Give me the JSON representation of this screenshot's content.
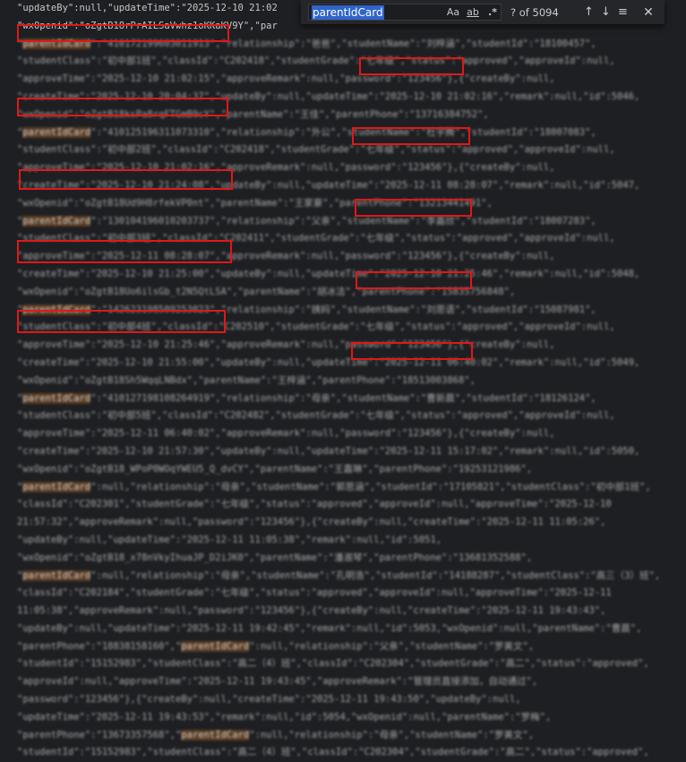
{
  "find_widget": {
    "query": "parentIdCard",
    "match_case_label": "Aa",
    "whole_word_label": "ab",
    "regex_label": ".*",
    "match_count": "? of 5094",
    "prev_icon": "arrow-up-icon",
    "next_icon": "arrow-down-icon",
    "selection_icon": "find-in-selection-icon",
    "close_icon": "close-icon"
  },
  "editor": {
    "lines": [
      {
        "text": "\"updateBy\":null,\"updateTime\":\"2025-12-10 21:02",
        "blur": false
      },
      {
        "text": "\"wxOpenid\":\"oZgtB18rPrAILSaVwhz1oKKaKV9Y\",\"par",
        "blur": false
      },
      {
        "text": "\"parentIdCard\":\"410172199603011913\",\"relationship\":\"爸爸\",\"studentName\":\"刘梓涵\",\"studentId\":\"18100457\",",
        "blur": true
      },
      {
        "text": "\"studentClass\":\"初中部1班\",\"classId\":\"C202418\",\"studentGrade\":\"七年级\",\"status\":\"approved\",\"approveId\":null,",
        "blur": true
      },
      {
        "text": "\"approveTime\":\"2025-12-10 21:02:15\",\"approveRemark\":null,\"password\":\"123456\"},{\"createBy\":null,",
        "blur": true
      },
      {
        "text": "\"createTime\":\"2025-12-10 20:04:37\",\"updateBy\":null,\"updateTime\":\"2025-12-10 21:02:16\",\"remark\":null,\"id\":5046,",
        "blur": true
      },
      {
        "text": "\"wxOpenid\":\"oZgtB18ksPa8rqFTGmB9cY\",\"parentName\":\"王佳\",\"parentPhone\":\"13716384752\",",
        "blur": true
      },
      {
        "text": "\"parentIdCard\":\"410125196311073310\",\"relationship\":\"外公\",\"studentName\":\"杜宇腾\",\"studentId\":\"18007083\",",
        "blur": true
      },
      {
        "text": "\"studentClass\":\"初中部2班\",\"classId\":\"C202418\",\"studentGrade\":\"七年级\",\"status\":\"approved\",\"approveId\":null,",
        "blur": true
      },
      {
        "text": "\"approveTime\":\"2025-12-10 21:02:16\",\"approveRemark\":null,\"password\":\"123456\"},{\"createBy\":null,",
        "blur": true
      },
      {
        "text": "\"createTime\":\"2025-12-10 21:24:08\",\"updateBy\":null,\"updateTime\":\"2025-12-11 08:28:07\",\"remark\":null,\"id\":5047,",
        "blur": true
      },
      {
        "text": "\"wxOpenid\":\"oZgtB18Ud9H8rfekVP0nt\",\"parentName\":\"王家豪\",\"parentPhone\":\"13213441491\",",
        "blur": true
      },
      {
        "text": "\"parentIdCard\":\"130104196010203737\",\"relationship\":\"父亲\",\"studentName\":\"李嘉欣\",\"studentId\":\"18007283\",",
        "blur": true
      },
      {
        "text": "\"studentClass\":\"初中部3班\",\"classId\":\"C202411\",\"studentGrade\":\"七年级\",\"status\":\"approved\",\"approveId\":null,",
        "blur": true
      },
      {
        "text": "\"approveTime\":\"2025-12-11 08:28:07\",\"approveRemark\":null,\"password\":\"123456\"},{\"createBy\":null,",
        "blur": true
      },
      {
        "text": "\"createTime\":\"2025-12-10 21:25:00\",\"updateBy\":null,\"updateTime\":\"2025-12-10 21:25:46\",\"remark\":null,\"id\":5048,",
        "blur": true
      },
      {
        "text": "\"wxOpenid\":\"oZgtB18Uo6ilsGb_t2N5QtLSA\",\"parentName\":\"胡冰洁\",\"parentPhone\":\"15835756848\",",
        "blur": true
      },
      {
        "text": "\"parentIdCard\":\"142623198509253023\",\"relationship\":\"姨妈\",\"studentName\":\"刘思语\",\"studentId\":\"15087981\",",
        "blur": true
      },
      {
        "text": "\"studentClass\":\"初中部4班\",\"classId\":\"C202510\",\"studentGrade\":\"七年级\",\"status\":\"approved\",\"approveId\":null,",
        "blur": true
      },
      {
        "text": "\"approveTime\":\"2025-12-10 21:25:46\",\"approveRemark\":null,\"password\":\"123456\"},{\"createBy\":null,",
        "blur": true
      },
      {
        "text": "\"createTime\":\"2025-12-10 21:55:00\",\"updateBy\":null,\"updateTime\":\"2025-12-11 06:40:02\",\"remark\":null,\"id\":5049,",
        "blur": true
      },
      {
        "text": "\"wxOpenid\":\"oZgtB18Sh5WqqLNBdx\",\"parentName\":\"王梓涵\",\"parentPhone\":\"18513003868\",",
        "blur": true
      },
      {
        "text": "\"parentIdCard\":\"410127198108264919\",\"relationship\":\"母亲\",\"studentName\":\"曹新晨\",\"studentId\":\"18126124\",",
        "blur": true
      },
      {
        "text": "\"studentClass\":\"初中部5班\",\"classId\":\"C202482\",\"studentGrade\":\"七年级\",\"status\":\"approved\",\"approveId\":null,",
        "blur": true
      },
      {
        "text": "\"approveTime\":\"2025-12-11 06:40:02\",\"approveRemark\":null,\"password\":\"123456\"},{\"createBy\":null,",
        "blur": true
      },
      {
        "text": "\"createTime\":\"2025-12-10 21:57:30\",\"updateBy\":null,\"updateTime\":\"2025-12-11 15:17:02\",\"remark\":null,\"id\":5050,",
        "blur": true
      },
      {
        "text": "\"wxOpenid\":\"oZgtB18_WPoP0WOqYWEU5_Q_dvCY\",\"parentName\":\"王嘉琳\",\"parentPhone\":\"19253121986\",",
        "blur": true
      },
      {
        "text": "\"parentIdCard\":null,\"relationship\":\"母亲\",\"studentName\":\"郭思涵\",\"studentId\":\"17105821\",\"studentClass\":\"初中部1班\",",
        "blur": true
      },
      {
        "text": "\"classId\":\"C202301\",\"studentGrade\":\"七年级\",\"status\":\"approved\",\"approveId\":null,\"approveTime\":\"2025-12-10",
        "blur": true
      },
      {
        "text": "21:57:32\",\"approveRemark\":null,\"password\":\"123456\"},{\"createBy\":null,\"createTime\":\"2025-12-11 11:05:26\",",
        "blur": true
      },
      {
        "text": "\"updateBy\":null,\"updateTime\":\"2025-12-11 11:05:38\",\"remark\":null,\"id\":5051,",
        "blur": true
      },
      {
        "text": "\"wxOpenid\":\"oZgtB18_x78nVkyIhuaJP_D2iJK0\",\"parentName\":\"潘淑琴\",\"parentPhone\":\"13681352588\",",
        "blur": true
      },
      {
        "text": "\"parentIdCard\":null,\"relationship\":\"母亲\",\"studentName\":\"孔明浩\",\"studentId\":\"14188287\",\"studentClass\":\"高三（3）班\",",
        "blur": true
      },
      {
        "text": "\"classId\":\"C202184\",\"studentGrade\":\"七年级\",\"status\":\"approved\",\"approveId\":null,\"approveTime\":\"2025-12-11",
        "blur": true
      },
      {
        "text": "11:05:38\",\"approveRemark\":null,\"password\":\"123456\"},{\"createBy\":null,\"createTime\":\"2025-12-11 19:43:43\",",
        "blur": true
      },
      {
        "text": "\"updateBy\":null,\"updateTime\":\"2025-12-11 19:42:45\",\"remark\":null,\"id\":5053,\"wxOpenid\":null,\"parentName\":\"曹晨\",",
        "blur": true
      },
      {
        "text": "\"parentPhone\":\"18838158160\",\"parentIdCard\":null,\"relationship\":\"父亲\",\"studentName\":\"罗美文\",",
        "blur": true
      },
      {
        "text": "\"studentId\":\"15152983\",\"studentClass\":\"高二（4）班\",\"classId\":\"C202304\",\"studentGrade\":\"高二\",\"status\":\"approved\",",
        "blur": true
      },
      {
        "text": "\"approveId\":null,\"approveTime\":\"2025-12-11 19:43:45\",\"approveRemark\":\"管理员直接添加，自动通过\",",
        "blur": true
      },
      {
        "text": "\"password\":\"123456\"},{\"createBy\":null,\"createTime\":\"2025-12-11 19:43:50\",\"updateBy\":null,",
        "blur": true
      },
      {
        "text": "\"updateTime\":\"2025-12-11 19:43:53\",\"remark\":null,\"id\":5054,\"wxOpenid\":null,\"parentName\":\"罗梅\",",
        "blur": true
      },
      {
        "text": "\"parentPhone\":\"13673357568\",\"parentIdCard\":null,\"relationship\":\"母亲\",\"studentName\":\"罗美文\",",
        "blur": true
      },
      {
        "text": "\"studentId\":\"15152983\",\"studentClass\":\"高二（4）班\",\"classId\":\"C202304\",\"studentGrade\":\"高二\",\"status\":\"approved\",",
        "blur": true
      }
    ]
  },
  "annotations": {
    "color": "#e01818",
    "match_highlight_color": "#5a3b22"
  }
}
